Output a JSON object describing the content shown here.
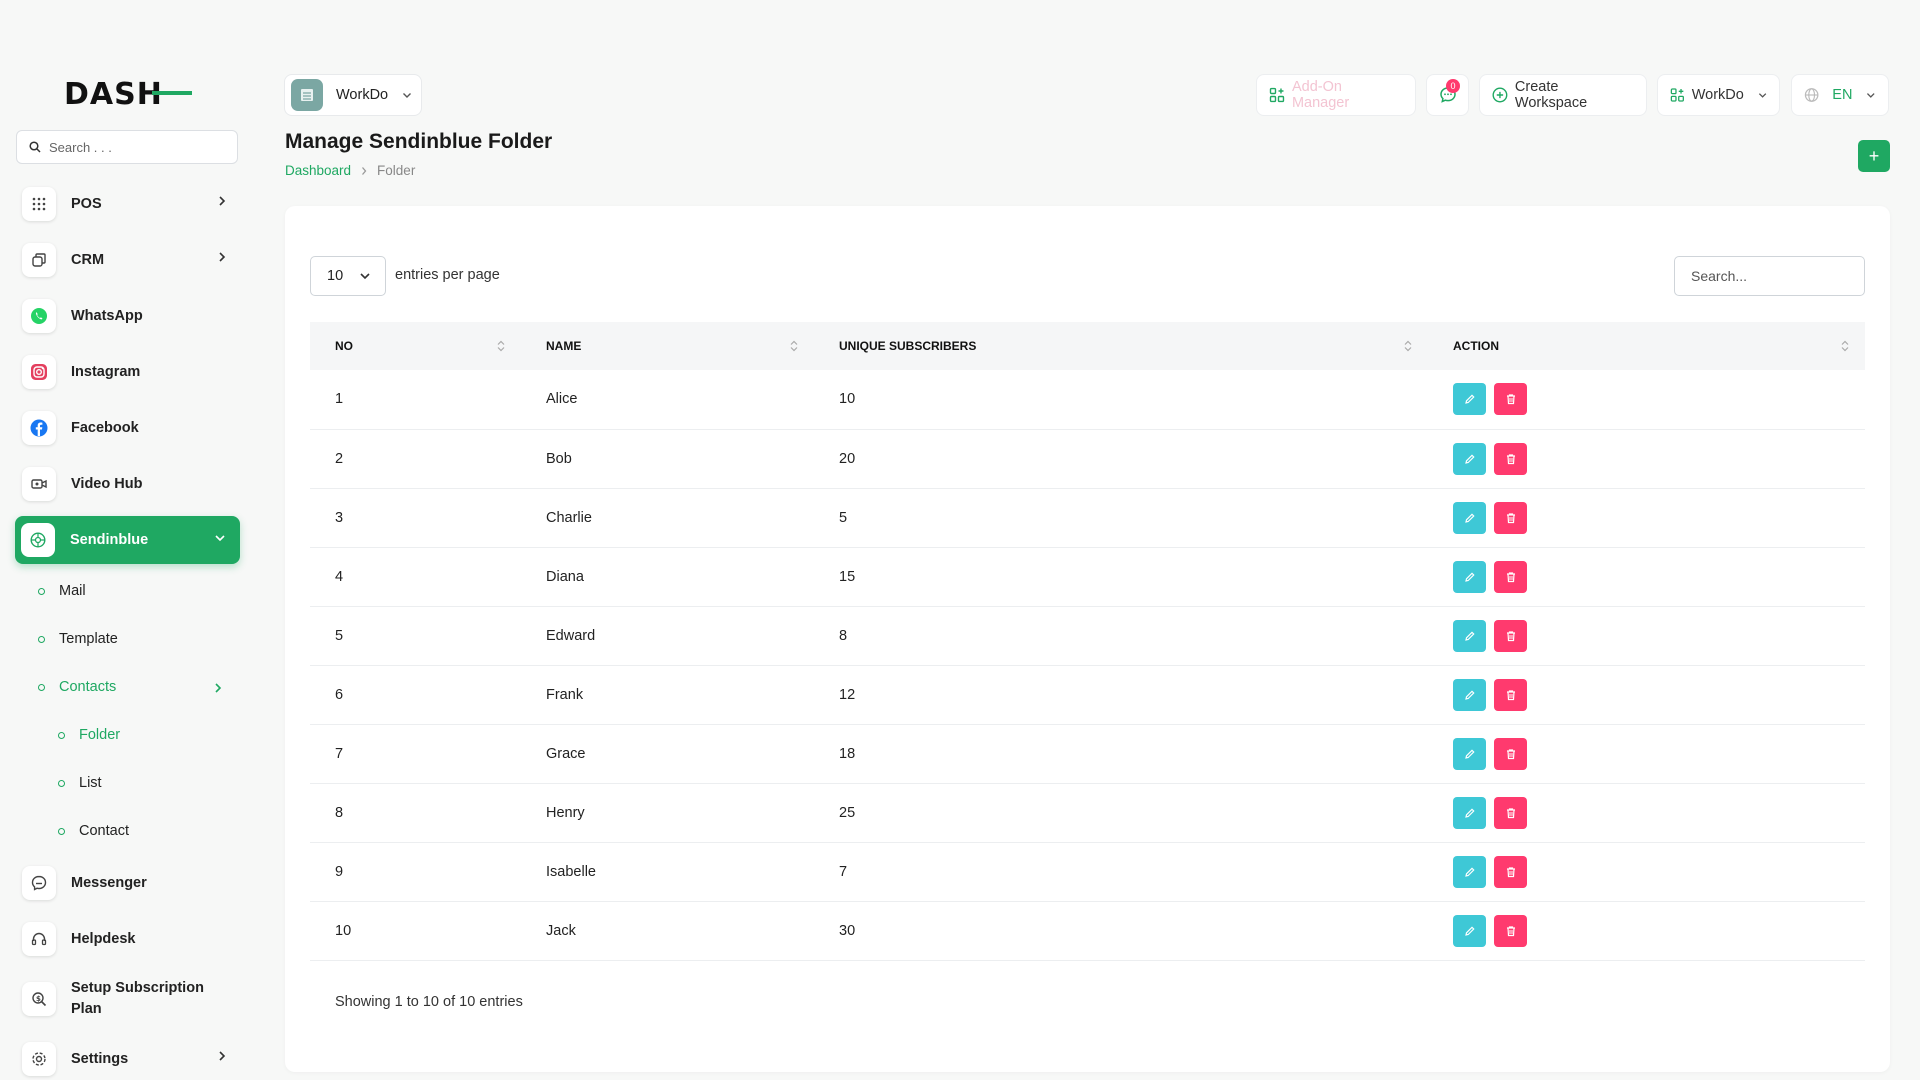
{
  "app": {
    "logo_text": "DASH"
  },
  "sidebar": {
    "search_placeholder": "Search . . .",
    "items": [
      {
        "label": "POS",
        "icon": "grid-icon"
      },
      {
        "label": "CRM",
        "icon": "crm-icon"
      },
      {
        "label": "WhatsApp",
        "icon": "whatsapp-icon"
      },
      {
        "label": "Instagram",
        "icon": "instagram-icon"
      },
      {
        "label": "Facebook",
        "icon": "facebook-icon"
      },
      {
        "label": "Video Hub",
        "icon": "video-icon"
      },
      {
        "label": "Sendinblue",
        "icon": "sendinblue-icon"
      },
      {
        "label": "Messenger",
        "icon": "messenger-icon"
      },
      {
        "label": "Helpdesk",
        "icon": "headset-icon"
      },
      {
        "label": "Setup Subscription Plan",
        "icon": "subscription-icon"
      },
      {
        "label": "Settings",
        "icon": "gear-icon"
      }
    ],
    "sub_items": [
      "Mail",
      "Template",
      "Contacts"
    ],
    "contacts_sub": [
      "Folder",
      "List",
      "Contact"
    ]
  },
  "header": {
    "workspace": "WorkDo",
    "addon_manager": "Add-On Manager",
    "notification_count": "0",
    "create_workspace": "Create Workspace",
    "workspace_menu": "WorkDo",
    "language": "EN"
  },
  "page": {
    "title": "Manage Sendinblue Folder",
    "breadcrumb": [
      "Dashboard",
      "Folder"
    ],
    "add_button": "+"
  },
  "table": {
    "per_page": "10",
    "per_page_label": "entries per page",
    "search_placeholder": "Search...",
    "columns": [
      "NO",
      "NAME",
      "UNIQUE SUBSCRIBERS",
      "ACTION"
    ],
    "rows": [
      {
        "no": "1",
        "name": "Alice",
        "subs": "10"
      },
      {
        "no": "2",
        "name": "Bob",
        "subs": "20"
      },
      {
        "no": "3",
        "name": "Charlie",
        "subs": "5"
      },
      {
        "no": "4",
        "name": "Diana",
        "subs": "15"
      },
      {
        "no": "5",
        "name": "Edward",
        "subs": "8"
      },
      {
        "no": "6",
        "name": "Frank",
        "subs": "12"
      },
      {
        "no": "7",
        "name": "Grace",
        "subs": "18"
      },
      {
        "no": "8",
        "name": "Henry",
        "subs": "25"
      },
      {
        "no": "9",
        "name": "Isabelle",
        "subs": "7"
      },
      {
        "no": "10",
        "name": "Jack",
        "subs": "30"
      }
    ],
    "footer": "Showing 1 to 10 of 10 entries"
  },
  "colors": {
    "accent": "#1fa862",
    "edit": "#3ec8d6",
    "delete": "#ff3a6e"
  }
}
